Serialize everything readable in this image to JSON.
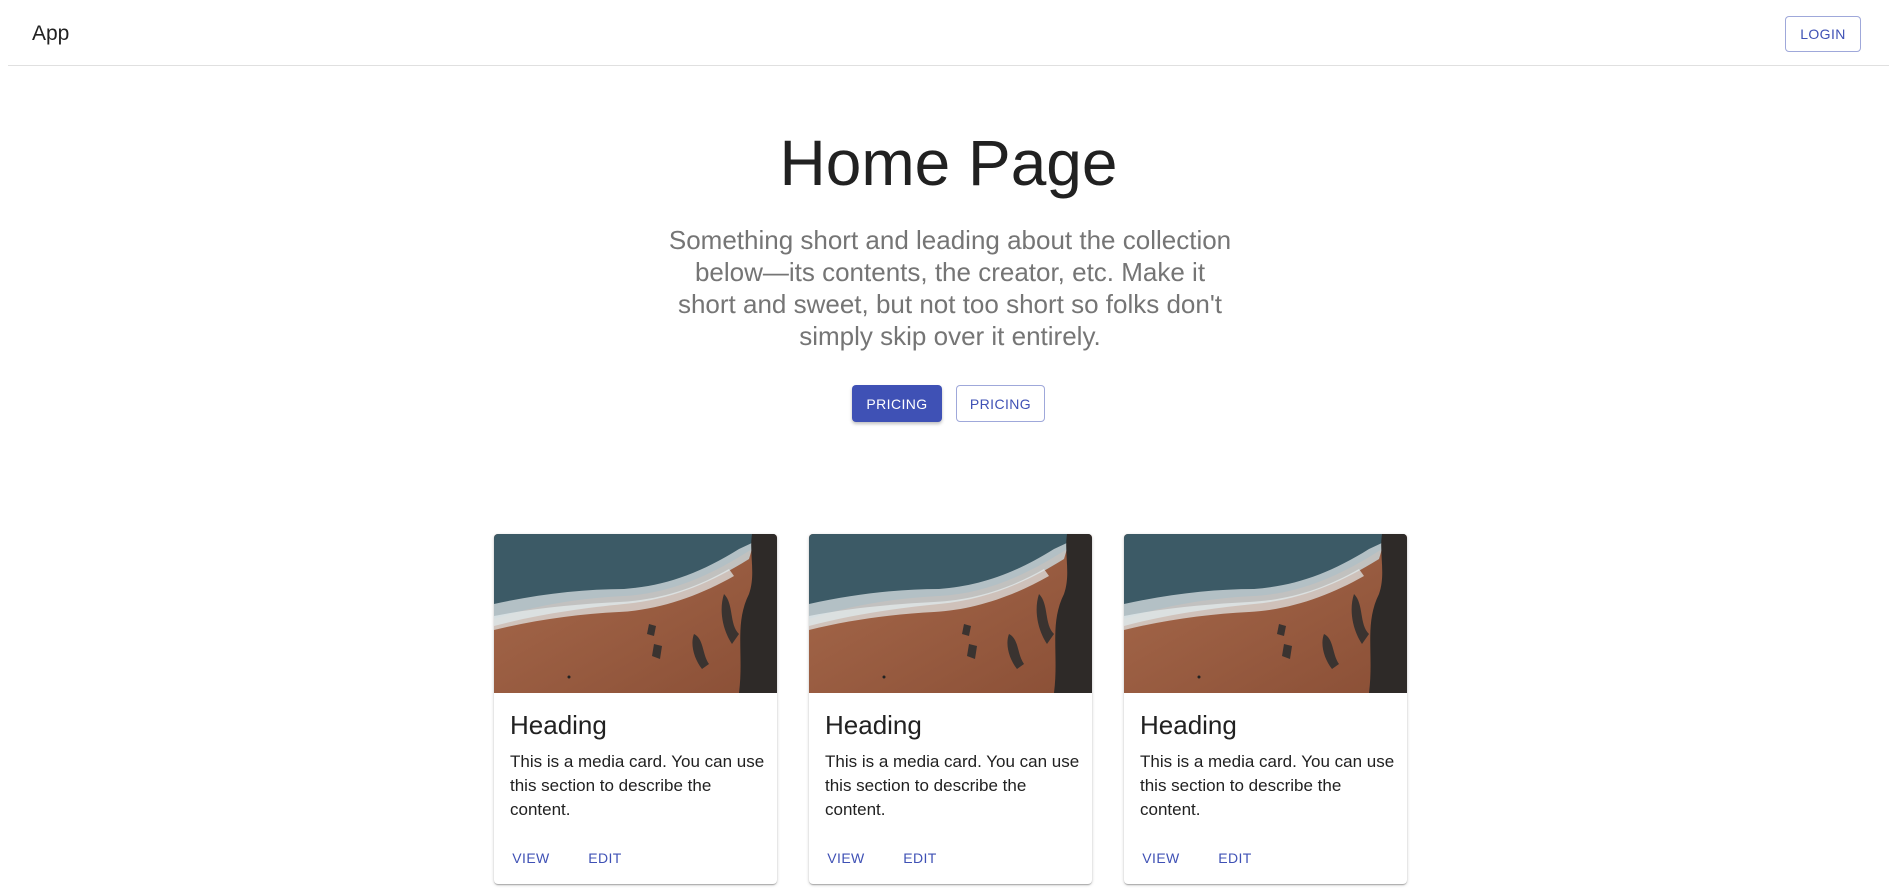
{
  "appbar": {
    "title": "App",
    "login_label": "LOGIN"
  },
  "hero": {
    "title": "Home Page",
    "subtitle": "Something short and leading about the collection below—its contents, the creator, etc. Make it short and sweet, but not too short so folks don't simply skip over it entirely.",
    "primary_button": "PRICING",
    "secondary_button": "PRICING"
  },
  "cards": [
    {
      "heading": "Heading",
      "text": "This is a media card. You can use this section to describe the content.",
      "view_label": "VIEW",
      "edit_label": "EDIT"
    },
    {
      "heading": "Heading",
      "text": "This is a media card. You can use this section to describe the content.",
      "view_label": "VIEW",
      "edit_label": "EDIT"
    },
    {
      "heading": "Heading",
      "text": "This is a media card. You can use this section to describe the content.",
      "view_label": "VIEW",
      "edit_label": "EDIT"
    }
  ],
  "colors": {
    "primary": "#3f51b5",
    "text": "#212121",
    "secondary_text": "#757575"
  }
}
